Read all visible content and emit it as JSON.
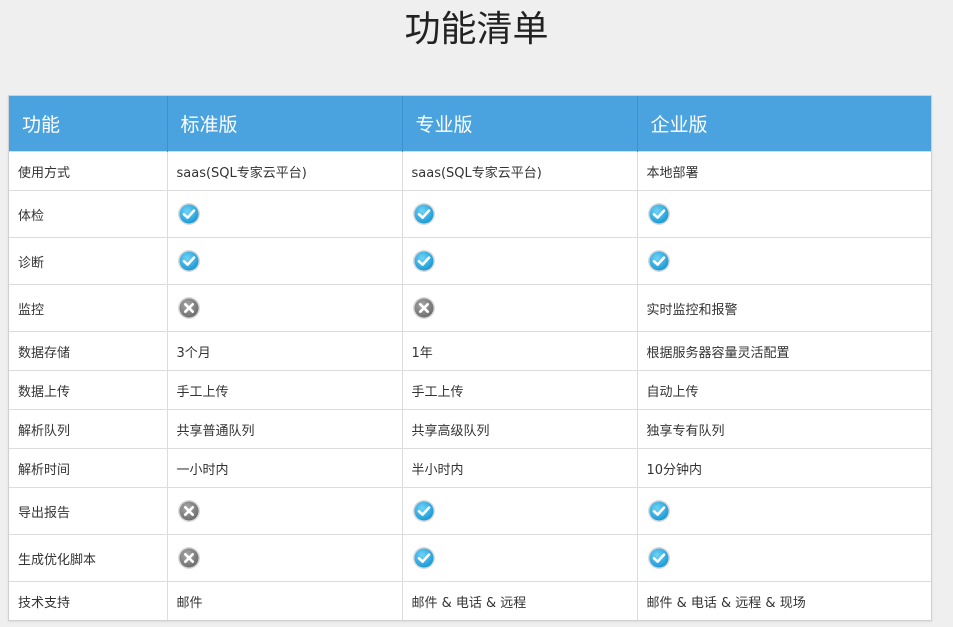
{
  "title": "功能清单",
  "colors": {
    "header_bg": "#4aa3df",
    "check": "#29a9e0",
    "cross": "#7d7d7d"
  },
  "header": [
    "功能",
    "标准版",
    "专业版",
    "企业版"
  ],
  "rows": [
    {
      "cells": [
        {
          "type": "text",
          "value": "使用方式"
        },
        {
          "type": "text",
          "value": "saas(SQL专家云平台)"
        },
        {
          "type": "text",
          "value": "saas(SQL专家云平台)"
        },
        {
          "type": "text",
          "value": "本地部署"
        }
      ]
    },
    {
      "cells": [
        {
          "type": "text",
          "value": "体检"
        },
        {
          "type": "icon",
          "icon": "check-icon"
        },
        {
          "type": "icon",
          "icon": "check-icon"
        },
        {
          "type": "icon",
          "icon": "check-icon"
        }
      ]
    },
    {
      "cells": [
        {
          "type": "text",
          "value": "诊断"
        },
        {
          "type": "icon",
          "icon": "check-icon"
        },
        {
          "type": "icon",
          "icon": "check-icon"
        },
        {
          "type": "icon",
          "icon": "check-icon"
        }
      ]
    },
    {
      "cells": [
        {
          "type": "text",
          "value": "监控"
        },
        {
          "type": "icon",
          "icon": "cross-icon"
        },
        {
          "type": "icon",
          "icon": "cross-icon"
        },
        {
          "type": "text",
          "value": "实时监控和报警"
        }
      ]
    },
    {
      "cells": [
        {
          "type": "text",
          "value": "数据存储"
        },
        {
          "type": "text",
          "value": "3个月"
        },
        {
          "type": "text",
          "value": "1年"
        },
        {
          "type": "text",
          "value": "根据服务器容量灵活配置"
        }
      ]
    },
    {
      "cells": [
        {
          "type": "text",
          "value": "数据上传"
        },
        {
          "type": "text",
          "value": "手工上传"
        },
        {
          "type": "text",
          "value": "手工上传"
        },
        {
          "type": "text",
          "value": "自动上传"
        }
      ]
    },
    {
      "cells": [
        {
          "type": "text",
          "value": "解析队列"
        },
        {
          "type": "text",
          "value": "共享普通队列"
        },
        {
          "type": "text",
          "value": "共享高级队列"
        },
        {
          "type": "text",
          "value": "独享专有队列"
        }
      ]
    },
    {
      "cells": [
        {
          "type": "text",
          "value": "解析时间"
        },
        {
          "type": "text",
          "value": "一小时内"
        },
        {
          "type": "text",
          "value": "半小时内"
        },
        {
          "type": "text",
          "value": "10分钟内"
        }
      ]
    },
    {
      "cells": [
        {
          "type": "text",
          "value": "导出报告"
        },
        {
          "type": "icon",
          "icon": "cross-icon"
        },
        {
          "type": "icon",
          "icon": "check-icon"
        },
        {
          "type": "icon",
          "icon": "check-icon"
        }
      ]
    },
    {
      "cells": [
        {
          "type": "text",
          "value": "生成优化脚本"
        },
        {
          "type": "icon",
          "icon": "cross-icon"
        },
        {
          "type": "icon",
          "icon": "check-icon"
        },
        {
          "type": "icon",
          "icon": "check-icon"
        }
      ]
    },
    {
      "cells": [
        {
          "type": "text",
          "value": "技术支持"
        },
        {
          "type": "text",
          "value": "邮件"
        },
        {
          "type": "text",
          "value": "邮件 & 电话 & 远程"
        },
        {
          "type": "text",
          "value": "邮件 & 电话 & 远程 & 现场"
        }
      ]
    }
  ]
}
